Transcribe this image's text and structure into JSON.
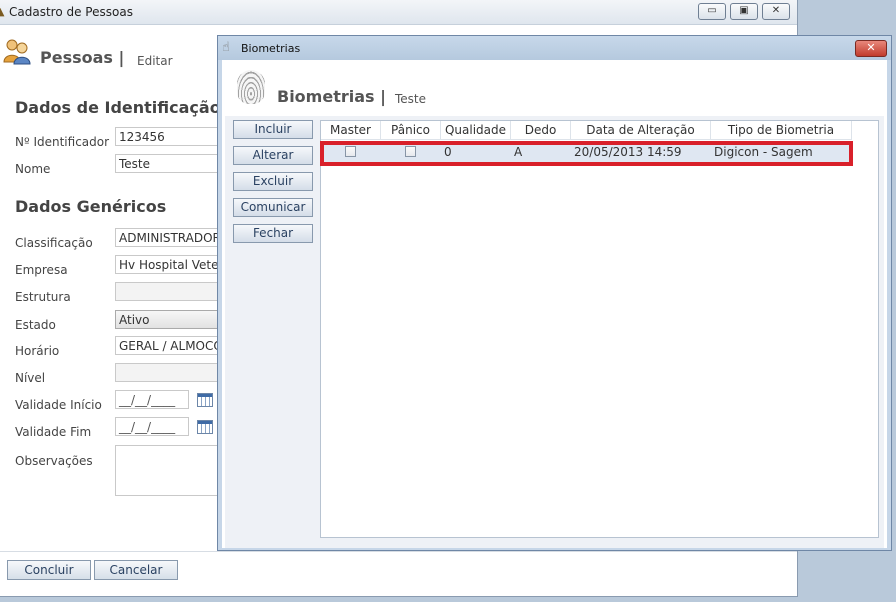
{
  "main_window": {
    "title": "Cadastro de Pessoas",
    "header": {
      "title": "Pessoas |",
      "subtitle": "Editar"
    },
    "identification": {
      "section_title": "Dados de Identificação",
      "id_label": "Nº Identificador",
      "id_value": "123456",
      "name_label": "Nome",
      "name_value": "Teste"
    },
    "generic": {
      "section_title": "Dados Genéricos",
      "classificacao_label": "Classificação",
      "classificacao_value": "ADMINISTRADOR",
      "empresa_label": "Empresa",
      "empresa_value": "Hv Hospital Veter",
      "estrutura_label": "Estrutura",
      "estrutura_value": "",
      "estado_label": "Estado",
      "estado_value": "Ativo",
      "horario_label": "Horário",
      "horario_value": "GERAL / ALMOCO",
      "nivel_label": "Nível",
      "nivel_value": "",
      "validade_inicio_label": "Validade Início",
      "validade_inicio_value": "__/__/____",
      "validade_fim_label": "Validade Fim",
      "validade_fim_value": "__/__/____",
      "observacoes_label": "Observações"
    },
    "footer": {
      "concluir": "Concluir",
      "cancelar": "Cancelar"
    },
    "window_buttons": {
      "minimize": "▭",
      "maximize": "▣",
      "close": "✕"
    }
  },
  "dialog": {
    "title": "Biometrias",
    "header": {
      "title": "Biometrias |",
      "subtitle": "Teste"
    },
    "buttons": {
      "incluir": "Incluir",
      "alterar": "Alterar",
      "excluir": "Excluir",
      "comunicar": "Comunicar",
      "fechar": "Fechar"
    },
    "close_glyph": "✕",
    "table": {
      "columns": [
        "Master",
        "Pânico",
        "Qualidade",
        "Dedo",
        "Data de Alteração",
        "Tipo de Biometria"
      ],
      "rows": [
        {
          "master": false,
          "panico": false,
          "qualidade": "0",
          "dedo": "A",
          "data": "20/05/2013 14:59",
          "tipo": "Digicon - Sagem"
        }
      ]
    }
  },
  "colors": {
    "highlight": "#d9202a",
    "dialog_frame": "#c6d6e8",
    "selected_row": "#dfe7f2"
  },
  "icons": [
    "persons-icon",
    "fingerprint-icon",
    "calendar-icon",
    "close-icon"
  ]
}
